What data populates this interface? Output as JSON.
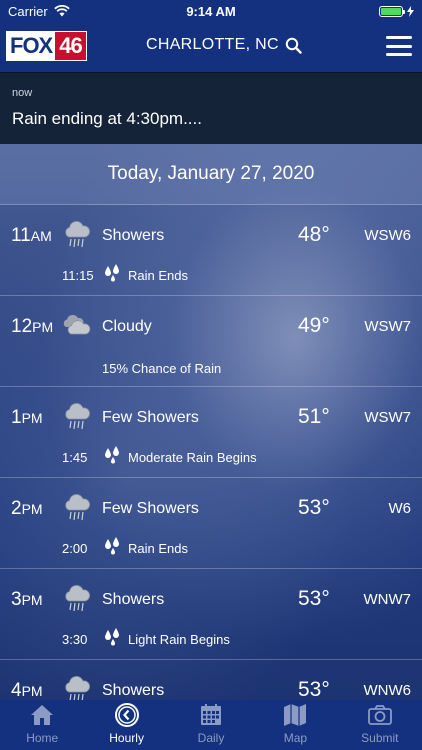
{
  "status_bar": {
    "carrier": "Carrier",
    "time": "9:14 AM",
    "battery_level": 1.0
  },
  "header": {
    "logo_text": "FOX",
    "logo_number": "46",
    "location": "CHARLOTTE, NC",
    "search_icon": "search-icon",
    "menu_icon": "menu-icon"
  },
  "alert": {
    "time": "now",
    "message": "Rain ending at 4:30pm...."
  },
  "date_header": "Today, January 27, 2020",
  "hours": [
    {
      "hour": "11",
      "ampm": "AM",
      "icon": "rain-cloud-icon",
      "condition": "Showers",
      "temp": "48°",
      "wind": "WSW6",
      "sub_time": "11:15",
      "sub_text": "Rain Ends"
    },
    {
      "hour": "12",
      "ampm": "PM",
      "icon": "cloud-icon",
      "condition": "Cloudy",
      "temp": "49°",
      "wind": "WSW7",
      "chance": "15% Chance of Rain"
    },
    {
      "hour": "1",
      "ampm": "PM",
      "icon": "rain-cloud-icon",
      "condition": "Few Showers",
      "temp": "51°",
      "wind": "WSW7",
      "sub_time": "1:45",
      "sub_text": "Moderate Rain Begins"
    },
    {
      "hour": "2",
      "ampm": "PM",
      "icon": "rain-cloud-icon",
      "condition": "Few Showers",
      "temp": "53°",
      "wind": "W6",
      "sub_time": "2:00",
      "sub_text": "Rain Ends"
    },
    {
      "hour": "3",
      "ampm": "PM",
      "icon": "rain-cloud-icon",
      "condition": "Showers",
      "temp": "53°",
      "wind": "WNW7",
      "sub_time": "3:30",
      "sub_text": "Light Rain Begins"
    },
    {
      "hour": "4",
      "ampm": "PM",
      "icon": "rain-cloud-icon",
      "condition": "Showers",
      "temp": "53°",
      "wind": "WNW6"
    }
  ],
  "tabs": [
    {
      "label": "Home",
      "icon": "home-icon",
      "active": false
    },
    {
      "label": "Hourly",
      "icon": "clock-icon",
      "active": true
    },
    {
      "label": "Daily",
      "icon": "calendar-icon",
      "active": false
    },
    {
      "label": "Map",
      "icon": "map-icon",
      "active": false
    },
    {
      "label": "Submit",
      "icon": "camera-icon",
      "active": false
    }
  ],
  "colors": {
    "brand_blue": "#13317f",
    "fox_red": "#c8102e",
    "battery_green": "#4cd964"
  }
}
